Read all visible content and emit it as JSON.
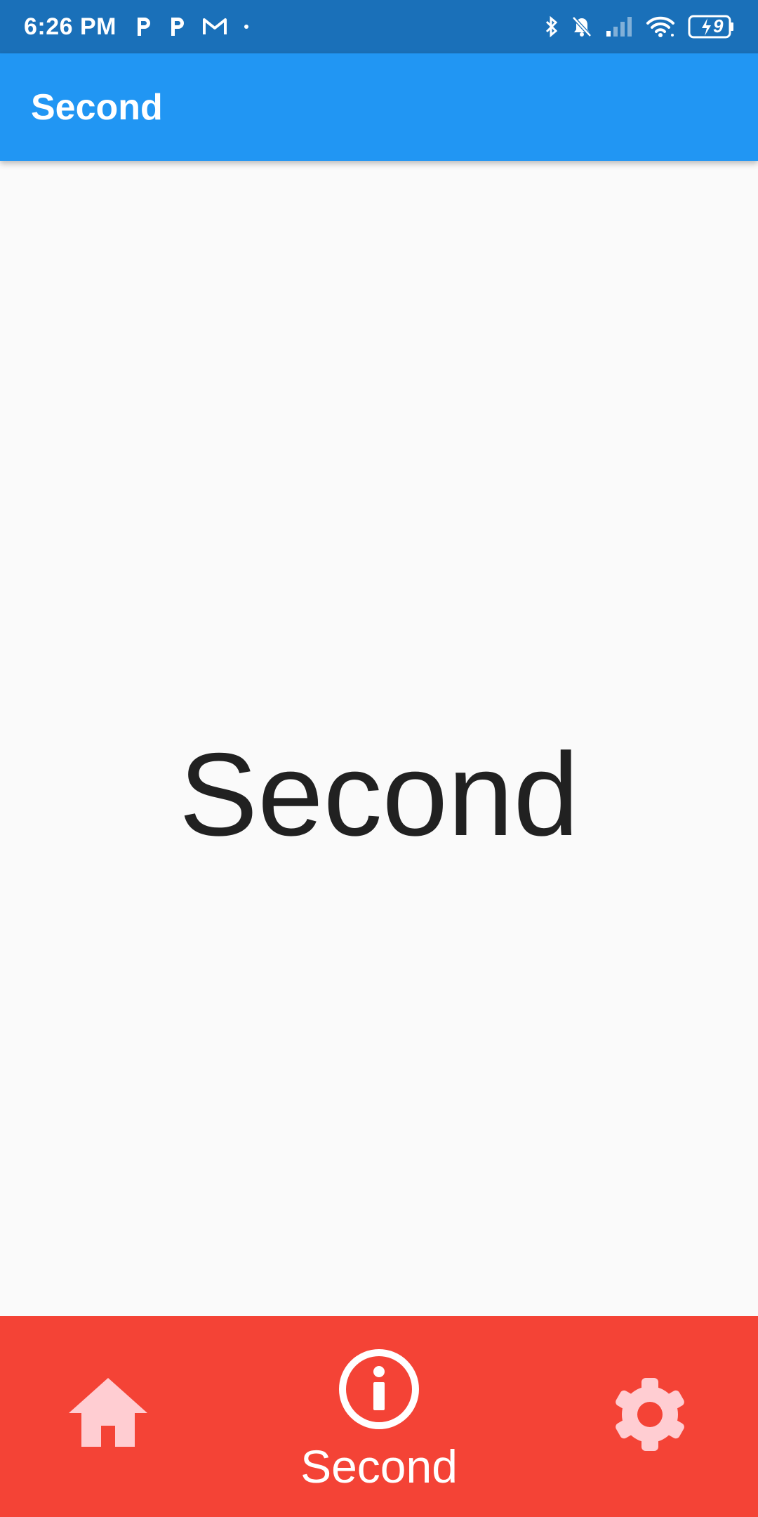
{
  "status_bar": {
    "time": "6:26 PM",
    "battery": "9",
    "icons": [
      "parking-icon",
      "parking-icon",
      "gmail-icon",
      "dot-icon",
      "bluetooth-icon",
      "bell-off-icon",
      "signal-icon",
      "wifi-icon",
      "battery-charging-icon"
    ]
  },
  "app_bar": {
    "title": "Second"
  },
  "main": {
    "center_text": "Second"
  },
  "bottom_nav": {
    "items": [
      {
        "icon": "home-icon",
        "label": "",
        "selected": false
      },
      {
        "icon": "info-icon",
        "label": "Second",
        "selected": true
      },
      {
        "icon": "settings-icon",
        "label": "",
        "selected": false
      }
    ]
  },
  "colors": {
    "status_bar": "#1a70b9",
    "app_bar": "#2196f3",
    "bottom_nav": "#f44336",
    "inactive_icon": "#ffcdd2"
  }
}
